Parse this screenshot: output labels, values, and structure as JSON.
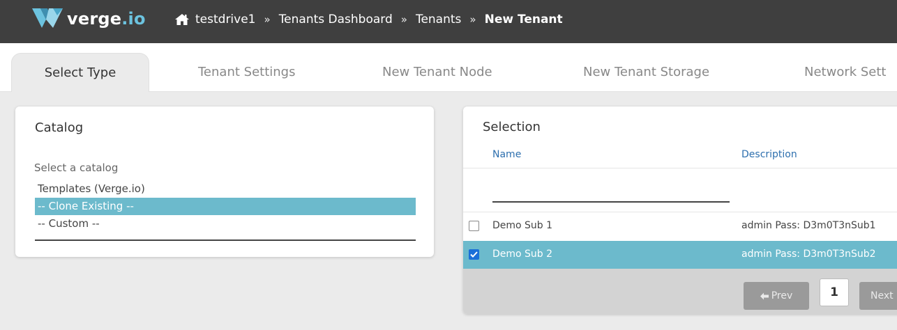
{
  "app": {
    "logo_brand": "verge",
    "logo_suffix": ".io"
  },
  "breadcrumb": {
    "items": [
      "testdrive1",
      "Tenants Dashboard",
      "Tenants"
    ],
    "current": "New Tenant",
    "separator": "»"
  },
  "tabs": [
    {
      "label": "Select Type",
      "active": true
    },
    {
      "label": "Tenant Settings",
      "active": false
    },
    {
      "label": "New Tenant Node",
      "active": false
    },
    {
      "label": "New Tenant Storage",
      "active": false
    },
    {
      "label": "Network Sett",
      "active": false
    }
  ],
  "catalog": {
    "title": "Catalog",
    "select_label": "Select a catalog",
    "options": [
      {
        "label": "Templates (Verge.io)",
        "selected": false
      },
      {
        "label": "-- Clone Existing --",
        "selected": true
      },
      {
        "label": "-- Custom --",
        "selected": false
      }
    ]
  },
  "selection": {
    "title": "Selection",
    "columns": [
      "Name",
      "Description"
    ],
    "rows": [
      {
        "name": "Demo Sub 1",
        "description": "admin Pass: D3m0T3nSub1",
        "checked": false
      },
      {
        "name": "Demo Sub 2",
        "description": "admin Pass: D3m0T3nSub2",
        "checked": true
      }
    ],
    "pager": {
      "prev_label": "Prev",
      "page": "1",
      "next_label": "Next"
    }
  },
  "colors": {
    "topbar": "#3f3f3f",
    "accent": "#6cbacc",
    "link": "#2d6fae",
    "checkbox": "#1a6fd8"
  },
  "icons": {
    "logo": "verge-v-logo-icon",
    "home": "home-icon",
    "prev": "arrow-left-icon",
    "check": "checkmark-icon"
  }
}
